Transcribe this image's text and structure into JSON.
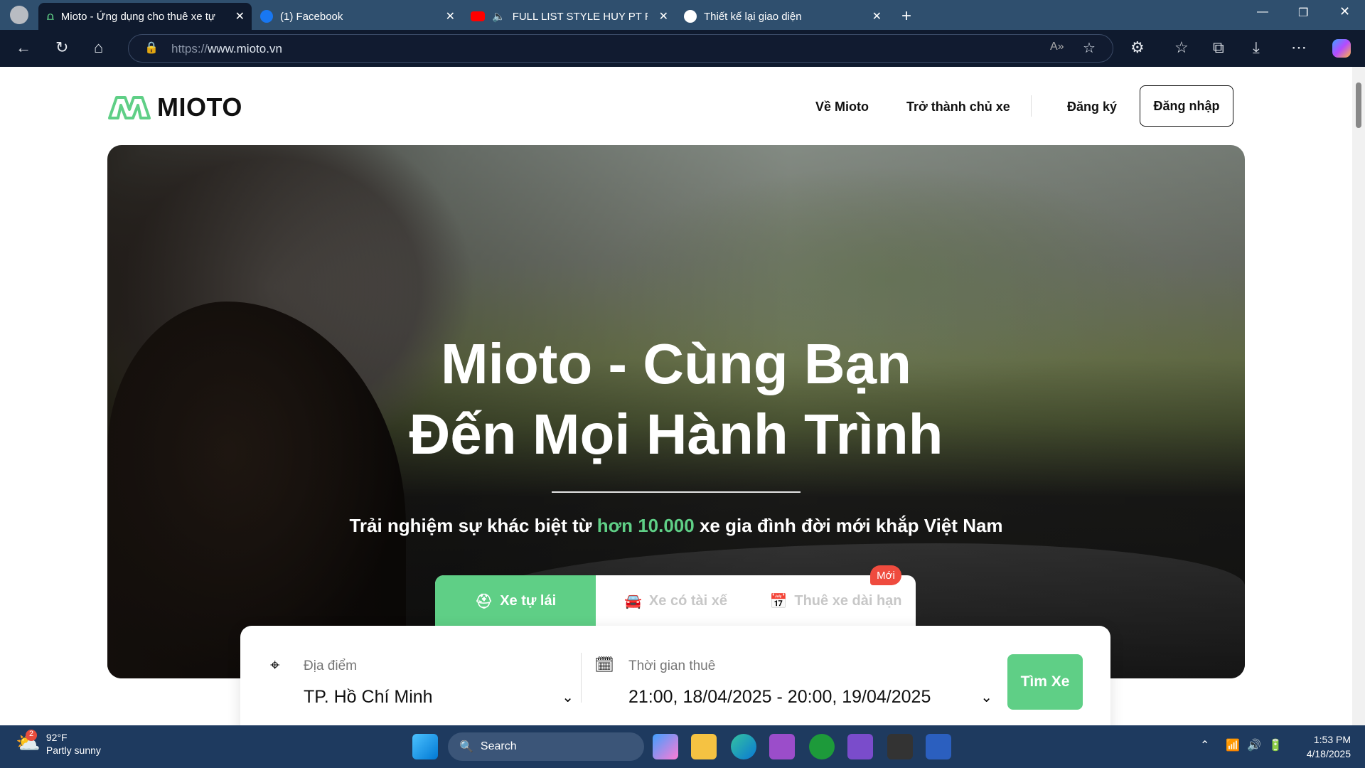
{
  "browser": {
    "tabs": [
      {
        "title": "Mioto - Ứng dụng cho thuê xe tự",
        "active": true
      },
      {
        "title": "(1) Facebook"
      },
      {
        "title": "FULL LIST STYLE HUY PT REM"
      },
      {
        "title": "Thiết kế lại giao diện"
      }
    ],
    "url_prefix": "https://",
    "url_host": "www.mioto.vn",
    "new_tab": "+",
    "close": "✕"
  },
  "header": {
    "logo": "MIOTO",
    "nav": [
      "Về Mioto",
      "Trở thành chủ xe",
      "Đăng ký"
    ],
    "login": "Đăng nhập"
  },
  "hero": {
    "title_line1": "Mioto - Cùng Bạn",
    "title_line2": "Đến Mọi Hành Trình",
    "subtitle_pre": "Trải nghiệm sự khác biệt từ ",
    "subtitle_highlight": "hơn 10.000",
    "subtitle_post": " xe gia đình đời mới khắp Việt Nam",
    "accent": "#5fcf86"
  },
  "search": {
    "tabs": [
      "Xe tự lái",
      "Xe có tài xế",
      "Thuê xe dài hạn"
    ],
    "badge": "Mới",
    "location_label": "Địa điểm",
    "location_value": "TP. Hồ Chí Minh",
    "time_label": "Thời gian thuê",
    "time_value": "21:00, 18/04/2025 - 20:00, 19/04/2025",
    "button": "Tìm Xe"
  },
  "taskbar": {
    "weather_temp": "92°F",
    "weather_desc": "Partly sunny",
    "weather_badge": "2",
    "search": "Search",
    "time": "1:53 PM",
    "date": "4/18/2025"
  }
}
